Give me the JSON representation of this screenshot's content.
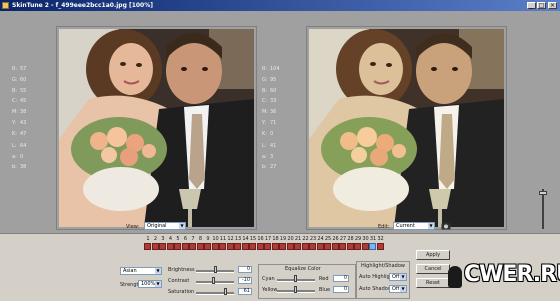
{
  "window": {
    "title": "SkinTune 2 - f_499eee2bcc1a0.jpg [100%]"
  },
  "readouts_left": [
    {
      "key": "R:",
      "value": "57"
    },
    {
      "key": "G:",
      "value": "60"
    },
    {
      "key": "B:",
      "value": "55"
    },
    {
      "key": "C:",
      "value": "45"
    },
    {
      "key": "M:",
      "value": "38"
    },
    {
      "key": "Y:",
      "value": "43"
    },
    {
      "key": "K:",
      "value": "47"
    },
    {
      "key": "L:",
      "value": "64"
    },
    {
      "key": "a:",
      "value": "0"
    },
    {
      "key": "b:",
      "value": "38"
    }
  ],
  "readouts_right": [
    {
      "key": "R:",
      "value": "104"
    },
    {
      "key": "G:",
      "value": "95"
    },
    {
      "key": "B:",
      "value": "60"
    },
    {
      "key": "C:",
      "value": "33"
    },
    {
      "key": "M:",
      "value": "36"
    },
    {
      "key": "Y:",
      "value": "71"
    },
    {
      "key": "K:",
      "value": "0"
    },
    {
      "key": "L:",
      "value": "41"
    },
    {
      "key": "a:",
      "value": "3"
    },
    {
      "key": "b:",
      "value": "27"
    }
  ],
  "view": {
    "label": "View:",
    "value": "Original"
  },
  "edit": {
    "label": "Edit:",
    "value": "Current"
  },
  "timeline": {
    "numbers": [
      "1",
      "2",
      "3",
      "4",
      "5",
      "6",
      "7",
      "8",
      "9",
      "10",
      "11",
      "12",
      "13",
      "14",
      "15",
      "16",
      "17",
      "18",
      "19",
      "20",
      "21",
      "22",
      "23",
      "24",
      "25",
      "26",
      "27",
      "28",
      "29",
      "30",
      "31",
      "32"
    ],
    "selected_index": 30
  },
  "skin_type": {
    "value": "Asian"
  },
  "strength": {
    "label": "Strength",
    "value": "100%"
  },
  "adjust": [
    {
      "label": "Brightness",
      "value": "0",
      "level": 0.5
    },
    {
      "label": "Contrast",
      "value": "-10",
      "level": 0.45
    },
    {
      "label": "Saturation",
      "value": "61",
      "level": 0.8
    }
  ],
  "equalize": {
    "title": "Equalize Color",
    "cyan": "Cyan",
    "red": "Red",
    "red_value": "0",
    "yellow": "Yellow",
    "blue": "Blue",
    "blue_value": "0"
  },
  "highlight_shadow": {
    "title": "Highlight/Shadow",
    "auto_highlights": {
      "label": "Auto Highlights",
      "value": "Off"
    },
    "auto_shadows": {
      "label": "Auto Shadows",
      "value": "Off"
    }
  },
  "buttons": {
    "apply": "Apply",
    "cancel": "Cancel",
    "reset": "Reset"
  },
  "watermark": "CWER.RU"
}
